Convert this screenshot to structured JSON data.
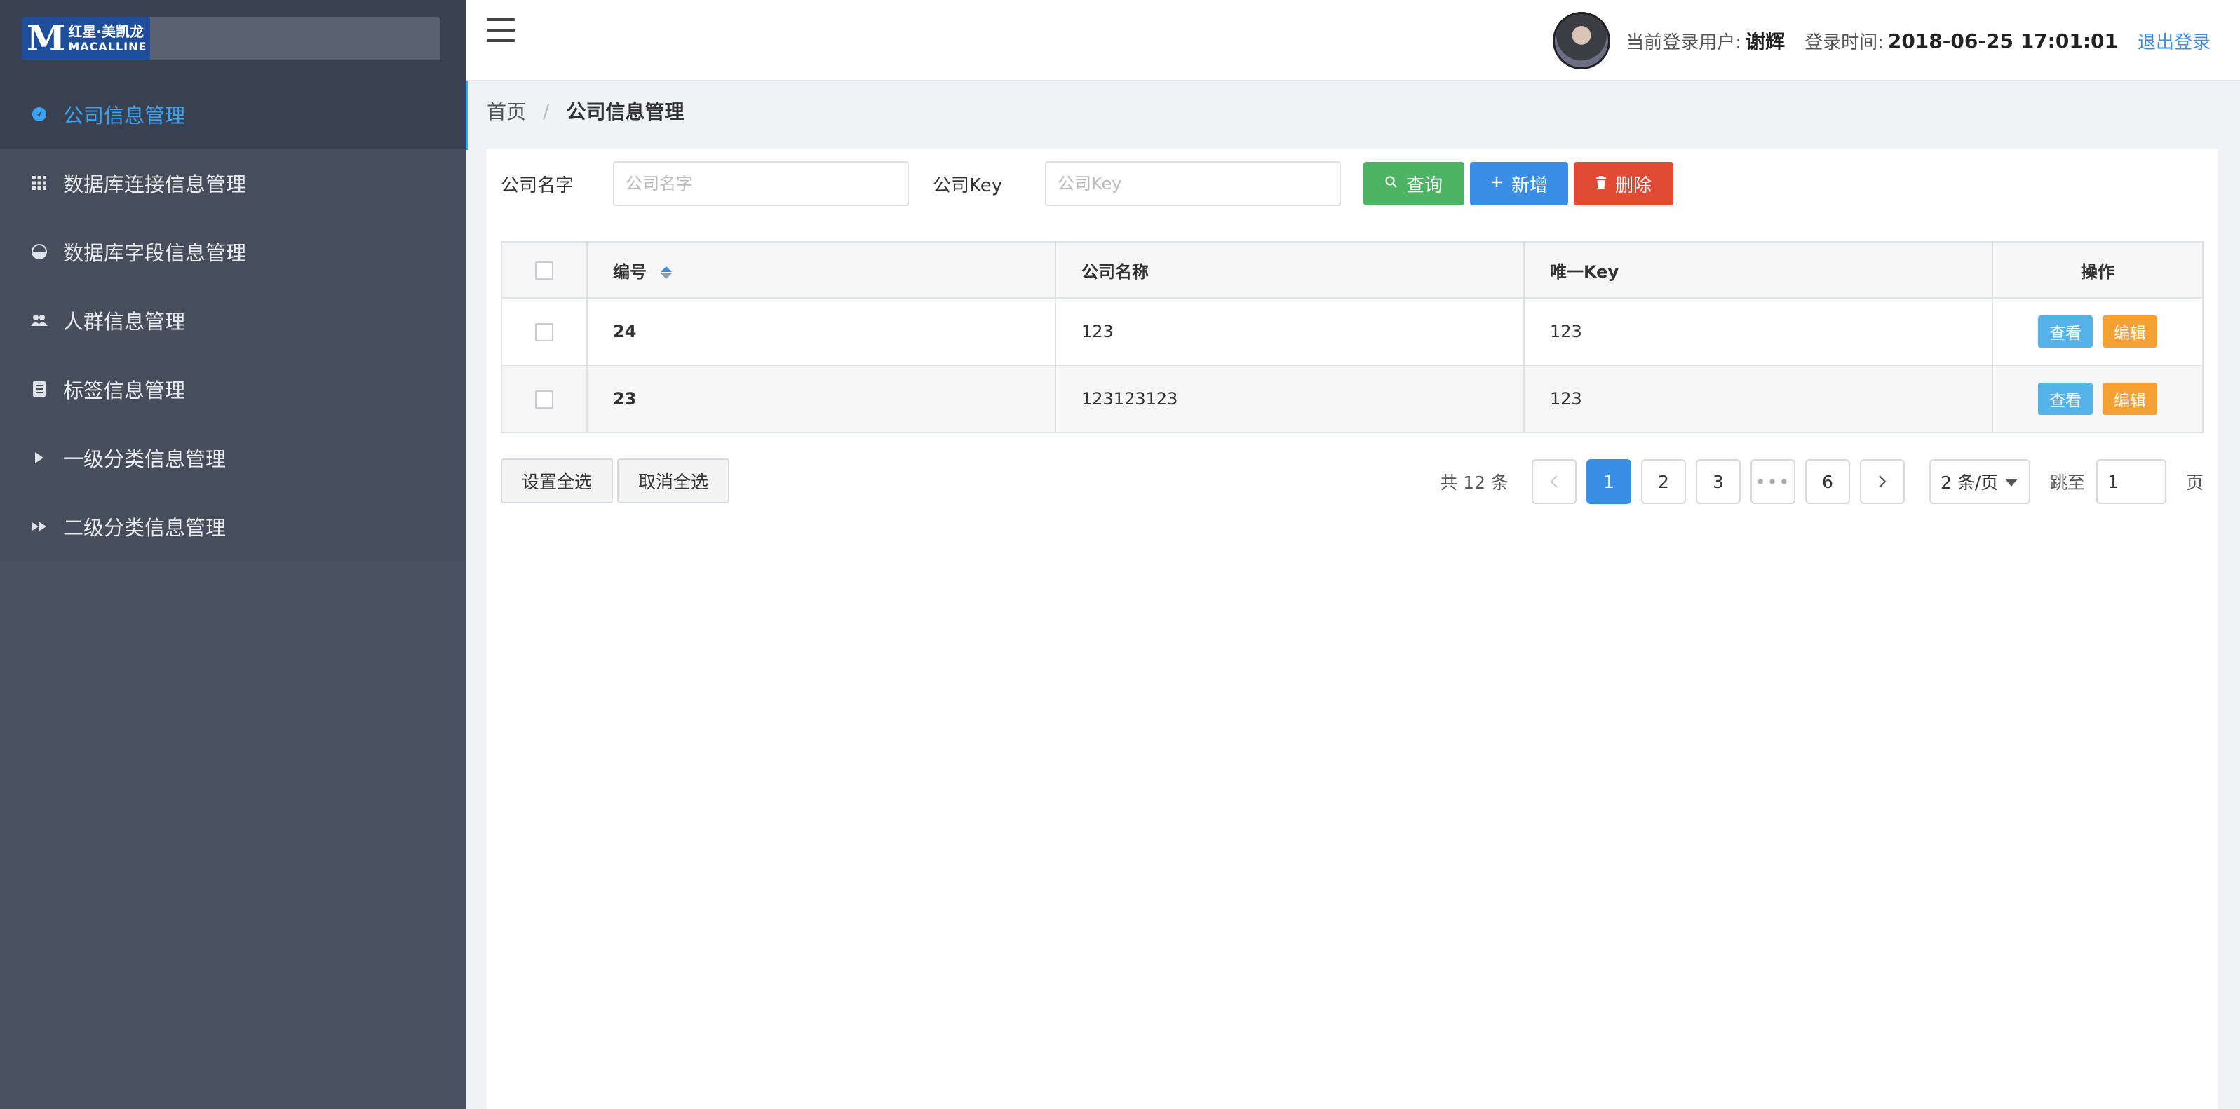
{
  "brand": {
    "logo_letter": "M",
    "logo_cn": "红星·美凯龙",
    "logo_en": "MACALLINE"
  },
  "sidebar": {
    "items": [
      {
        "label": "公司信息管理",
        "icon": "circle-arrow-icon",
        "active": true
      },
      {
        "label": "数据库连接信息管理",
        "icon": "grid-icon",
        "active": false
      },
      {
        "label": "数据库字段信息管理",
        "icon": "pie-icon",
        "active": false
      },
      {
        "label": "人群信息管理",
        "icon": "users-icon",
        "active": false
      },
      {
        "label": "标签信息管理",
        "icon": "book-icon",
        "active": false
      },
      {
        "label": "一级分类信息管理",
        "icon": "play-icon",
        "active": false
      },
      {
        "label": "二级分类信息管理",
        "icon": "fast-forward-icon",
        "active": false
      }
    ]
  },
  "header": {
    "user_label": "当前登录用户:",
    "user_name": "谢辉",
    "time_label": "登录时间:",
    "time_value": "2018-06-25 17:01:01",
    "logout": "退出登录"
  },
  "breadcrumb": {
    "home": "首页",
    "separator": "/",
    "current": "公司信息管理"
  },
  "search": {
    "name_label": "公司名字",
    "name_placeholder": "公司名字",
    "key_label": "公司Key",
    "key_placeholder": "公司Key",
    "query": "查询",
    "add": "新增",
    "delete": "删除"
  },
  "table": {
    "columns": [
      "编号",
      "公司名称",
      "唯一Key",
      "操作"
    ],
    "rows": [
      {
        "id": "24",
        "name": "123",
        "key": "123"
      },
      {
        "id": "23",
        "name": "123123123",
        "key": "123"
      }
    ],
    "view": "查看",
    "edit": "编辑"
  },
  "actions": {
    "select_all": "设置全选",
    "deselect_all": "取消全选"
  },
  "pagination": {
    "total": "共 12 条",
    "pages": [
      "1",
      "2",
      "3",
      "•••",
      "6"
    ],
    "current": "1",
    "page_size": "2 条/页",
    "jump_label": "跳至",
    "jump_value": "1",
    "page_unit": "页"
  },
  "colors": {
    "sidebar": "#4a5160",
    "active": "#3aa3f5",
    "query": "#4cb463",
    "add": "#3a8ee6",
    "delete": "#e04a35",
    "view": "#55b3ea",
    "edit": "#f4a033"
  }
}
